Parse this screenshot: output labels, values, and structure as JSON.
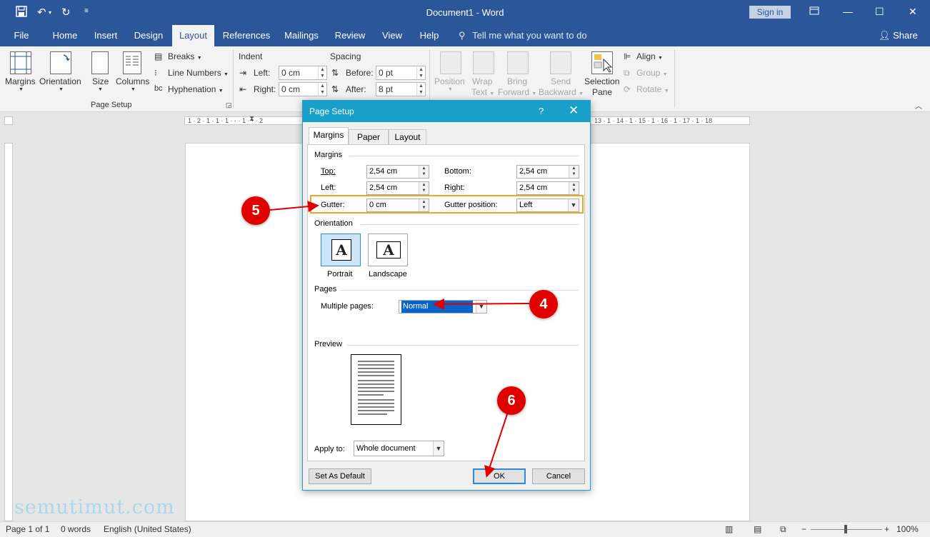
{
  "window": {
    "title": "Document1 - Word",
    "sign_in": "Sign in"
  },
  "tabs": [
    "File",
    "Home",
    "Insert",
    "Design",
    "Layout",
    "References",
    "Mailings",
    "Review",
    "View",
    "Help"
  ],
  "active_tab": "Layout",
  "tell_me": "Tell me what you want to do",
  "share": "Share",
  "ribbon": {
    "margins": "Margins",
    "orientation": "Orientation",
    "size": "Size",
    "columns": "Columns",
    "breaks": "Breaks",
    "line_numbers": "Line Numbers",
    "hyphenation": "Hyphenation",
    "page_setup_group": "Page Setup",
    "indent": "Indent",
    "indent_left_label": "Left:",
    "indent_left_value": "0 cm",
    "indent_right_label": "Right:",
    "indent_right_value": "0 cm",
    "spacing": "Spacing",
    "before_label": "Before:",
    "before_value": "0 pt",
    "after_label": "After:",
    "after_value": "8 pt",
    "position": "Position",
    "wrap": "Wrap",
    "text": "Text",
    "bring": "Bring",
    "forward": "Forward",
    "send": "Send",
    "backward": "Backward",
    "selection": "Selection",
    "pane": "Pane",
    "align": "Align",
    "group": "Group",
    "rotate": "Rotate"
  },
  "ruler": {
    "top_left": "1 · 2 · 1 · 1 · 1 · · · 1 · · · 2",
    "top_right": "13 · 1 · 14 · 1 · 15 · 1 · 16 · 1 · 17 · 1 · 18"
  },
  "dialog": {
    "title": "Page Setup",
    "help": "?",
    "close": "✕",
    "tabs": [
      "Margins",
      "Paper",
      "Layout"
    ],
    "margins_group": "Margins",
    "top_label": "Top:",
    "top_value": "2,54 cm",
    "bottom_label": "Bottom:",
    "bottom_value": "2,54 cm",
    "left_label": "Left:",
    "left_value": "2,54 cm",
    "right_label": "Right:",
    "right_value": "2,54 cm",
    "gutter_label": "Gutter:",
    "gutter_value": "0 cm",
    "gutter_position_label": "Gutter position:",
    "gutter_position_value": "Left",
    "orientation_group": "Orientation",
    "portrait": "Portrait",
    "landscape": "Landscape",
    "pages_group": "Pages",
    "multiple_pages_label": "Multiple pages:",
    "multiple_pages_value": "Normal",
    "preview_group": "Preview",
    "apply_to_label": "Apply to:",
    "apply_to_value": "Whole document",
    "set_default": "Set As Default",
    "ok": "OK",
    "cancel": "Cancel"
  },
  "annotations": {
    "step4": "4",
    "step5": "5",
    "step6": "6",
    "arrow_color": "#e00000",
    "highlight_color": "#f3a81b"
  },
  "status": {
    "page": "Page 1 of 1",
    "words": "0 words",
    "language": "English (United States)",
    "zoom": "100%"
  },
  "watermark": "semutimut.com"
}
